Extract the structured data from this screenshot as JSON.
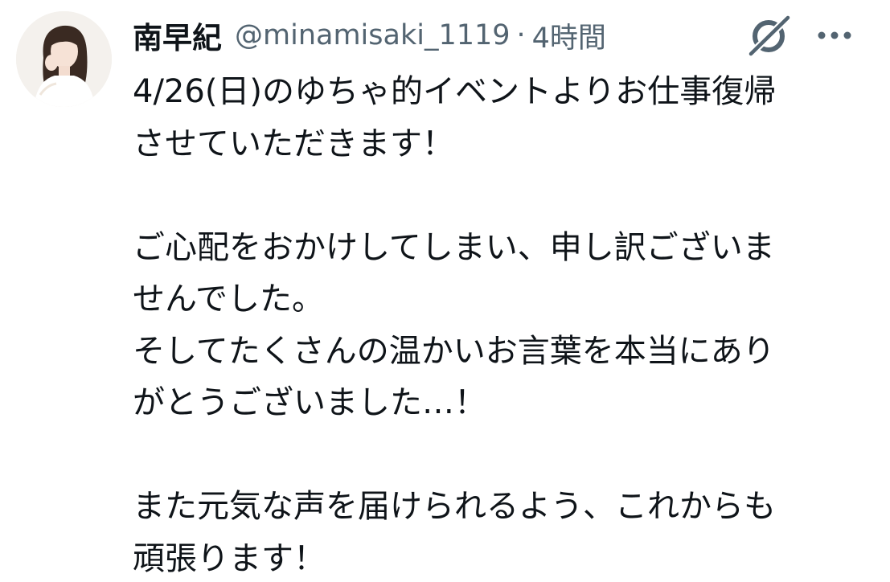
{
  "author": {
    "display_name": "南早紀",
    "handle": "@minamisaki_1119",
    "separator": "·",
    "time": "4時間"
  },
  "icons": {
    "avatar": "profile-photo",
    "grok": "grok-icon",
    "more": "more-horizontal-icon"
  },
  "colors": {
    "text_primary": "#0f1419",
    "text_secondary": "#536471"
  },
  "tweet": {
    "paragraphs": [
      {
        "lines": [
          "4/26(日)のゆちゃ的イベントよりお仕事復帰",
          "させていただきます！"
        ]
      },
      {
        "lines": [
          "ご心配をおかけしてしまい、申し訳ございま",
          "せんでした。",
          "そしてたくさんの温かいお言葉を本当にあり",
          "がとうございました…！"
        ]
      },
      {
        "lines": [
          "また元気な声を届けられるよう、これからも",
          "頑張ります！"
        ]
      }
    ]
  }
}
